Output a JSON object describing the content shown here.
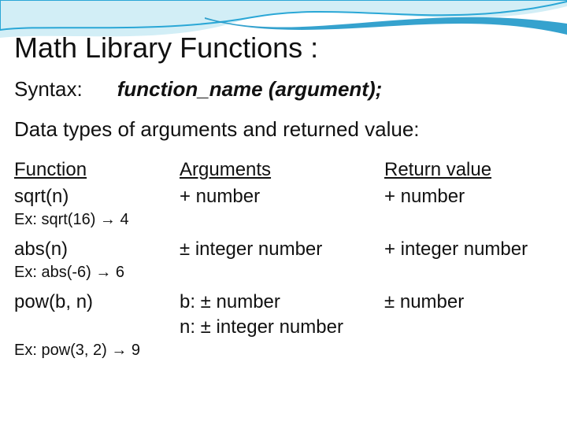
{
  "title": "Math Library Functions :",
  "syntax": {
    "label": "Syntax:",
    "value": "function_name  (argument);"
  },
  "dtypes": "Data types of arguments and returned value:",
  "headers": {
    "fn": "Function",
    "arg": "Arguments",
    "ret": "Return value"
  },
  "rows": {
    "sqrt": {
      "fn": "sqrt(n)",
      "arg": "+ number",
      "ret": "+ number",
      "ex": "Ex: sqrt(16) → 4"
    },
    "abs": {
      "fn": "abs(n)",
      "arg": "± integer number",
      "ret": "+ integer number",
      "ex": "Ex: abs(-6) → 6"
    },
    "pow": {
      "fn": "pow(b, n)",
      "arg1": "b: ± number",
      "arg2": "n: ± integer number",
      "ret": "± number",
      "ex": "Ex: pow(3, 2) → 9"
    }
  }
}
